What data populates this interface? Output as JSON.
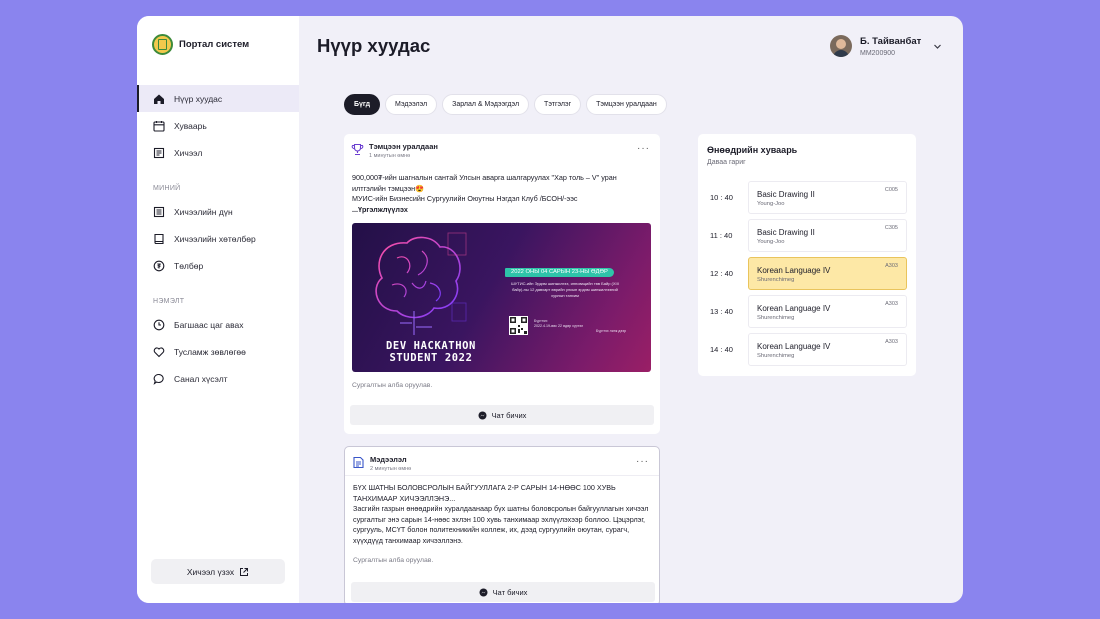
{
  "brand": {
    "name": "Портал систем"
  },
  "nav": {
    "items_main": [
      {
        "label": "Нүүр хуудас",
        "icon": "home-icon"
      },
      {
        "label": "Хуваарь",
        "icon": "calendar-icon"
      },
      {
        "label": "Хичээл",
        "icon": "course-icon"
      }
    ],
    "section_mine": "МИНИЙ",
    "items_mine": [
      {
        "label": "Хичээлийн дүн",
        "icon": "grades-icon"
      },
      {
        "label": "Хичээлийн хөтөлбөр",
        "icon": "book-icon"
      },
      {
        "label": "Төлбөр",
        "icon": "payment-icon"
      }
    ],
    "section_extra": "НЭМЭЛТ",
    "items_extra": [
      {
        "label": "Багшаас цаг авах",
        "icon": "clock-icon"
      },
      {
        "label": "Тусламж зөвлөгөө",
        "icon": "help-icon"
      },
      {
        "label": "Санал хүсэлт",
        "icon": "feedback-icon"
      }
    ],
    "footer_button": "Хичээл үзэх"
  },
  "header": {
    "title": "Нүүр хуудас",
    "user_name": "Б. Тайванбат",
    "user_id": "MM200900"
  },
  "filters": [
    "Бүгд",
    "Мэдээлэл",
    "Зарлал & Мэдээгдэл",
    "Тэтгэлэг",
    "Тэмцээн уралдаан"
  ],
  "posts": [
    {
      "category": "Тэмцээн уралдаан",
      "time": "1 минутын өмнө",
      "line1": "900,000₮-ийн шагналын сантай Улсын аварга шалгаруулах \"Хар толь – V\" уран илтгэлийн тэмцээн😍",
      "line2": "МУИС-ийн Бизнесийн Сургуулийн Оюутны Нэгдэл Клуб /БСОН/-ээс",
      "more": "...Үргэлжлүүлэх",
      "banner": {
        "title": "DEV HACKATHON STUDENT 2022",
        "date": "2022 ОНЫ 04 САРЫН 23-НЫ ӨДӨР",
        "desc": "ШУТИС-ийн Эрдэм шинжилгээ, инновацийн төв Байр (ХIII байр)-ны 12 давхарт өөрийн улсын эрдэм шинжилгээний хурлын танхим",
        "small": "Бүртгэл:",
        "small_line2": "2022.4.19-өөс 22 өдөр хүртэл",
        "small_right": "Бүртгэх линк дээр"
      },
      "comment_placeholder": "Сургалтын алба оруулав.",
      "chat_label": "Чат бичих"
    },
    {
      "category": "Мэдээлэл",
      "time": "2 минутын өмнө",
      "line1": "БҮХ ШАТНЫ БОЛОВСРОЛЫН БАЙГУУЛЛАГА 2-Р САРЫН 14-НӨӨС 100 ХУВЬ ТАНХИМААР ХИЧЭЭЛЛЭНЭ...",
      "line2": "Засгийн газрын өнөөдрийн хуралдаанаар бүх шатны боловсролын байгууллагын хичээл сургалтыг энэ сарын 14-нөөс эхлэн 100 хувь танхимаар эхлүүлэхээр боллоо. Цэцэрлэг, сургууль, МСҮТ болон политехникийн коллеж, их, дээд сургуулийн оюутан, сурагч, хүүхдүүд танхимаар хичээллэнэ.",
      "comment_placeholder": "Сургалтын алба оруулав.",
      "chat_label": "Чат бичих"
    }
  ],
  "schedule": {
    "title": "Өнөөдрийн хуваарь",
    "day": "Даваа гариг",
    "rows": [
      {
        "time": "10 : 40",
        "course": "Basic Drawing II",
        "teacher": "Young-Joo",
        "room": "C005",
        "highlight": false
      },
      {
        "time": "11 : 40",
        "course": "Basic Drawing II",
        "teacher": "Young-Joo",
        "room": "C305",
        "highlight": false
      },
      {
        "time": "12 : 40",
        "course": "Korean Language IV",
        "teacher": "Shurenchimeg",
        "room": "A303",
        "highlight": true
      },
      {
        "time": "13 : 40",
        "course": "Korean Language IV",
        "teacher": "Shurenchimeg",
        "room": "A303",
        "highlight": false
      },
      {
        "time": "14 : 40",
        "course": "Korean Language IV",
        "teacher": "Shurenchimeg",
        "room": "A303",
        "highlight": false
      }
    ]
  },
  "colors": {
    "background": "#8a84ee",
    "app_bg": "#f1f0f8",
    "accent_dark": "#1c1c28",
    "highlight": "#fde8a6",
    "trophy": "#6b3fd0"
  }
}
